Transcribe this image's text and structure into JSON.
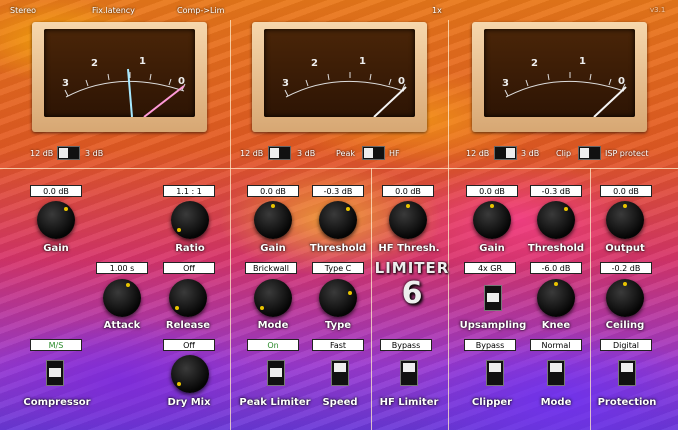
{
  "header": {
    "mode": "Stereo",
    "latency": "Fix.latency",
    "routing": "Comp->Lim",
    "oversampling": "1x",
    "version": "v3.1"
  },
  "meters": {
    "scale_labels": [
      "3",
      "2",
      "1",
      "0"
    ],
    "meter1": {
      "range_left": "12 dB",
      "range_right": "3 dB"
    },
    "meter2": {
      "range_left": "12 dB",
      "range_right": "3 dB",
      "peak_label": "Peak",
      "hf_label": "HF"
    },
    "meter3": {
      "range_left": "12 dB",
      "range_right": "3 dB",
      "clip_label": "Clip",
      "isp_label": "ISP protect"
    }
  },
  "compressor": {
    "gain": {
      "value": "0.0 dB",
      "label": "Gain"
    },
    "ratio": {
      "value": "1.1 : 1",
      "label": "Ratio"
    },
    "attack": {
      "value": "1.00 s",
      "label": "Attack"
    },
    "release": {
      "value": "Off",
      "label": "Release"
    },
    "mode": {
      "value": "M/S",
      "label": "Compressor"
    },
    "dry_mix": {
      "value": "Off",
      "label": "Dry Mix"
    }
  },
  "peak_limiter": {
    "gain": {
      "value": "0.0 dB",
      "label": "Gain"
    },
    "threshold": {
      "value": "-0.3 dB",
      "label": "Threshold"
    },
    "mode": {
      "value": "Brickwall",
      "label": "Mode"
    },
    "type": {
      "value": "Type C",
      "label": "Type"
    },
    "enable": {
      "value": "On",
      "label": "Peak Limiter"
    },
    "speed": {
      "value": "Fast",
      "label": "Speed"
    }
  },
  "hf_limiter": {
    "threshold": {
      "value": "0.0 dB",
      "label": "HF Thresh."
    },
    "bypass": {
      "value": "Bypass",
      "label": "HF Limiter"
    }
  },
  "logo": {
    "line1": "LIMITER",
    "line2": "6"
  },
  "clipper": {
    "gain": {
      "value": "0.0 dB",
      "label": "Gain"
    },
    "threshold": {
      "value": "-0.3 dB",
      "label": "Threshold"
    },
    "upsampling": {
      "value": "4x GR",
      "label": "Upsampling"
    },
    "knee": {
      "value": "-6.0 dB",
      "label": "Knee"
    },
    "bypass": {
      "value": "Bypass",
      "label": "Clipper"
    },
    "mode": {
      "value": "Normal",
      "label": "Mode"
    }
  },
  "output": {
    "output": {
      "value": "0.0 dB",
      "label": "Output"
    },
    "ceiling": {
      "value": "-0.2 dB",
      "label": "Ceiling"
    },
    "protection": {
      "value": "Digital",
      "label": "Protection"
    }
  },
  "colors": {
    "accent_knob_dot": "#e8c300",
    "needle_left": "#a6e8ff",
    "needle_right": "#ff9ad8"
  }
}
